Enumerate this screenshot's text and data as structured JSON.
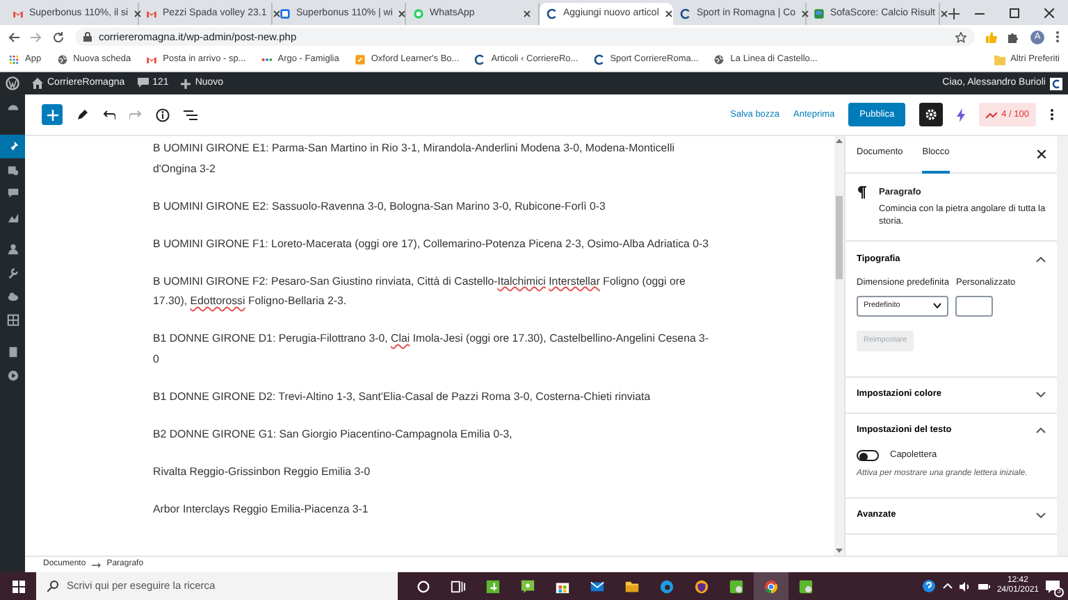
{
  "browser": {
    "tabs": [
      {
        "title": "Superbonus 110%, il si",
        "kind": "gmail",
        "selected": false
      },
      {
        "title": "Pezzi Spada volley 23.1",
        "kind": "gmail",
        "selected": false
      },
      {
        "title": "Superbonus 110% | wi",
        "kind": "blue",
        "selected": false
      },
      {
        "title": "WhatsApp",
        "kind": "whatsapp",
        "selected": false
      },
      {
        "title": "Aggiungi nuovo articol",
        "kind": "arc",
        "selected": true
      },
      {
        "title": "Sport in Romagna | Co",
        "kind": "arc",
        "selected": false
      },
      {
        "title": "SofaScore: Calcio Risult",
        "kind": "sofa",
        "selected": false
      }
    ],
    "url": "corriereromagna.it/wp-admin/post-new.php",
    "avatar": "A",
    "bookmarks": [
      {
        "label": "App",
        "kind": "apps"
      },
      {
        "label": "Nuova scheda",
        "kind": "globe"
      },
      {
        "label": "Posta in arrivo - sp...",
        "kind": "gmail"
      },
      {
        "label": "Argo - Famiglia",
        "kind": "dots"
      },
      {
        "label": "Oxford Learner's Bo...",
        "kind": "orange"
      },
      {
        "label": "Articoli ‹ CorriereRo...",
        "kind": "arc"
      },
      {
        "label": "Sport CorriereRoma...",
        "kind": "arc"
      },
      {
        "label": "La Linea di Castello...",
        "kind": "globe"
      }
    ],
    "other_bookmarks": "Altri Preferiti"
  },
  "admin_bar": {
    "site": "CorriereRomagna",
    "comments": "121",
    "new": "Nuovo",
    "greeting": "Ciao, Alessandro Burioli"
  },
  "admin_menu": [
    {
      "kind": "gauge",
      "selected": false
    },
    {
      "kind": "pin",
      "selected": true
    },
    {
      "kind": "media",
      "selected": false
    },
    {
      "kind": "comment",
      "selected": false
    },
    {
      "kind": "chart",
      "selected": false
    },
    {
      "kind": "user",
      "selected": false
    },
    {
      "kind": "wrench",
      "selected": false
    },
    {
      "kind": "cloud",
      "selected": false
    },
    {
      "kind": "grid",
      "selected": false
    },
    {
      "kind": "book",
      "selected": false
    },
    {
      "kind": "play",
      "selected": false
    }
  ],
  "toolbar": {
    "save_draft": "Salva bozza",
    "preview": "Anteprima",
    "publish": "Pubblica",
    "score": "4 / 100"
  },
  "paragraphs": [
    [
      {
        "text": "B UOMINI GIRONE E1: Parma-San Martino in Rio 3-1, Mirandola-Anderlini Modena 3-0, Modena-Monticelli d'Ongina 3-2",
        "misspelled": false
      }
    ],
    [
      {
        "text": "B UOMINI GIRONE E2: Sassuolo-Ravenna 3-0, Bologna-San Marino 3-0, Rubicone-Forlì 0-3",
        "misspelled": false
      }
    ],
    [
      {
        "text": "B UOMINI GIRONE F1: Loreto-Macerata (oggi ore 17), Collemarino-Potenza Picena 2-3, Osimo-Alba Adriatica 0-3",
        "misspelled": false
      }
    ],
    [
      {
        "text": "B UOMINI GIRONE F2: Pesaro-San Giustino rinviata, Città di Castello-",
        "misspelled": false
      },
      {
        "text": "Italchimici",
        "misspelled": true
      },
      {
        "text": " Interstellar",
        "misspelled": true
      },
      {
        "text": " Foligno (oggi ore 17.30), ",
        "misspelled": false
      },
      {
        "text": "Edottorossi",
        "misspelled": true
      },
      {
        "text": " Foligno-Bellaria 2-3.",
        "misspelled": false
      }
    ],
    [
      {
        "text": "B1 DONNE GIRONE D1: Perugia-Filottrano 3-0, ",
        "misspelled": false
      },
      {
        "text": "Clai",
        "misspelled": true
      },
      {
        "text": " Imola-Jesi (oggi ore 17.30), Castelbellino-Angelini Cesena 3-0",
        "misspelled": false
      }
    ],
    [
      {
        "text": "B1 DONNE GIRONE D2: Trevi-Altino 1-3, Sant'Elia-Casal de Pazzi Roma 3-0, Costerna-Chieti rinviata",
        "misspelled": false
      }
    ],
    [
      {
        "text": "B2 DONNE GIRONE G1: San Giorgio Piacentino-Campagnola Emilia 0-3,",
        "misspelled": false
      }
    ],
    [
      {
        "text": "Rivalta Reggio-Grissinbon Reggio Emilia 3-0",
        "misspelled": false
      }
    ],
    [
      {
        "text": "Arbor Interclays Reggio Emilia-Piacenza 3-1",
        "misspelled": false
      }
    ]
  ],
  "sidebar": {
    "tabs": [
      {
        "label": "Documento",
        "selected": false
      },
      {
        "label": "Blocco",
        "selected": true
      }
    ],
    "block": {
      "name": "Paragrafo",
      "description": "Comincia con la pietra angolare di tutta la storia."
    },
    "panels": [
      {
        "title": "Tipografia",
        "expanded": true,
        "size_label": "Dimensione predefinita",
        "custom_label": "Personalizzato",
        "size_value": "Predefinito",
        "reset": "Reimpostare",
        "reset_disabled": true
      },
      {
        "title": "Impostazioni colore",
        "expanded": false
      },
      {
        "title": "Impostazioni del testo",
        "expanded": true,
        "toggle_label": "Capolettera",
        "toggle_on": false,
        "help": "Attiva per mostrare una grande lettera iniziale."
      },
      {
        "title": "Avanzate",
        "expanded": false
      }
    ]
  },
  "breadcrumb": [
    "Documento",
    "Paragrafo"
  ],
  "taskbar": {
    "search_placeholder": "Scrivi qui per eseguire la ricerca",
    "apps": [
      {
        "kind": "cortana",
        "selected": false
      },
      {
        "kind": "taskview",
        "selected": false
      },
      {
        "kind": "greentile",
        "selected": false
      },
      {
        "kind": "greenchat",
        "selected": false
      },
      {
        "kind": "store",
        "selected": false
      },
      {
        "kind": "mail",
        "selected": false
      },
      {
        "kind": "folder",
        "selected": false
      },
      {
        "kind": "edge",
        "selected": false
      },
      {
        "kind": "shield",
        "selected": false
      },
      {
        "kind": "greenapp",
        "selected": false
      },
      {
        "kind": "chrome",
        "selected": true
      },
      {
        "kind": "greenapp",
        "selected": false
      }
    ],
    "time": "12:42",
    "date": "24/01/2021",
    "notifications": "3"
  }
}
